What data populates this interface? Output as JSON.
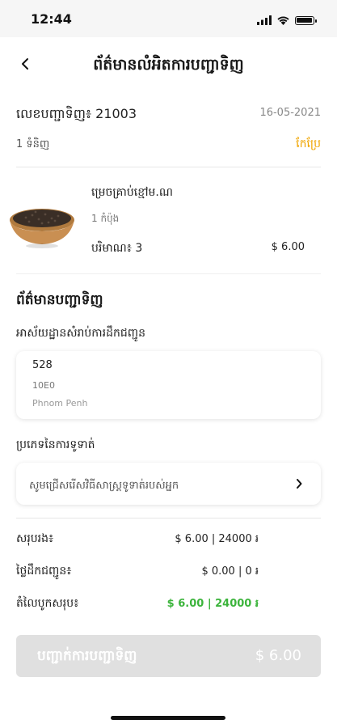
{
  "status_bar": {
    "time": "12:44"
  },
  "header": {
    "title": "ព័ត៌មានលំអិតការបញ្ជាទិញ"
  },
  "order": {
    "number": "លេខបញ្ជាទិញ៖ 21003",
    "date": "16-05-2021",
    "item_count": "1 ទំនិញ",
    "edit_label": "កែប្រែ"
  },
  "product": {
    "name": "ម្រេចគ្រាប់ខ្មៅម.ណ",
    "unit": "1 កំប៉ុង",
    "quantity": "បរិមាណ៖ 3",
    "price": "$ 6.00"
  },
  "order_info": {
    "title": "ព័ត៌មានបញ្ជាទិញ",
    "address_label": "អាស័យដ្ឋានសំរាប់ការដឹកជញ្ជូន",
    "address_line1": "528",
    "address_line2": "10E0",
    "address_line3": "Phnom Penh",
    "payment_label": "ប្រភេទនៃការទូទាត់",
    "payment_placeholder": "សូមជ្រើសរើសវិធីសាស្រ្តទូទាត់របស់អ្នក"
  },
  "summary": {
    "subtotal_label": "សរុបរង៖",
    "subtotal_value": "$ 6.00 | 24000 ៛",
    "delivery_label": "ថ្លៃដឹកជញ្ជូន៖",
    "delivery_value": "$ 0.00 | 0 ៛",
    "total_label": "តំលៃបូកសរុប៖",
    "total_value": "$ 6.00 | 24000 ៛"
  },
  "confirm": {
    "label": "បញ្ជាក់ការបញ្ជាទិញ",
    "total": "$ 6.00"
  },
  "colors": {
    "accent": "#f0a500",
    "total_green": "#3cb43c",
    "button_disabled": "#e0e0e0"
  },
  "icons": [
    "back-icon",
    "wifi-icon",
    "signal-icon",
    "battery-icon",
    "chevron-right-icon"
  ]
}
